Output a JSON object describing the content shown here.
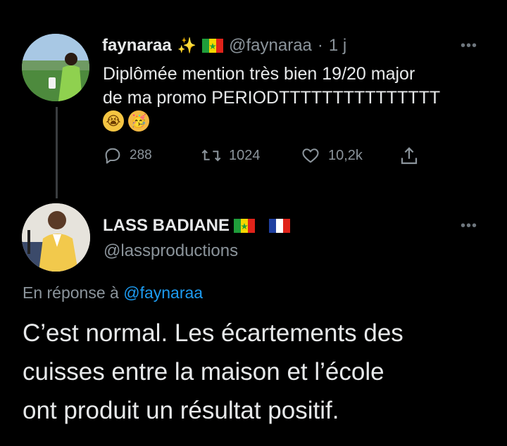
{
  "tweet": {
    "display_name": "faynaraa",
    "name_emoji": "✨",
    "handle": "@faynaraa",
    "sep": "·",
    "time": "1 j",
    "text_line1": "Diplômée mention très bien 19/20 major",
    "text_line2": "de ma promo PERIODTTTTTTTTTTTTTTT",
    "emoji1": "😭",
    "emoji2": "🥳",
    "more": "•••",
    "replies": "288",
    "retweets": "1024",
    "likes": "10,2k"
  },
  "reply": {
    "display_name": "LASS BADIANE",
    "handle": "@lassproductions",
    "more": "•••",
    "in_reply_prefix": "En réponse à",
    "in_reply_handle": "@faynaraa",
    "text_line1": "C’est normal. Les écartements des",
    "text_line2": "cuisses entre la maison et l’école",
    "text_line3": "ont produit un résultat positif."
  },
  "colors": {
    "background": "#000000",
    "text": "#e7e9ea",
    "muted": "#8b949b",
    "link": "#1d9bf0"
  },
  "icons": [
    "reply-icon",
    "retweet-icon",
    "like-icon",
    "share-icon",
    "senegal-flag-icon",
    "france-flag-icon"
  ]
}
